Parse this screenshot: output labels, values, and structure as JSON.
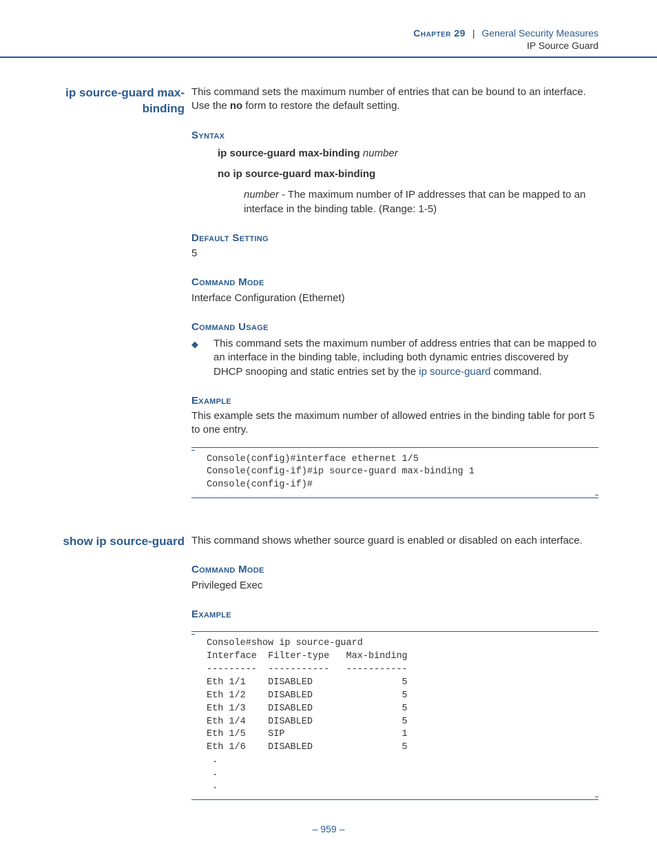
{
  "header": {
    "chapter": "Chapter 29",
    "title": "General Security Measures",
    "subtitle": "IP Source Guard"
  },
  "section1": {
    "heading": "ip source-guard max-binding",
    "intro_pre": "This command sets the maximum number of entries that can be bound to an interface. Use the ",
    "intro_bold": "no",
    "intro_post": " form to restore the default setting.",
    "syntax_label": "Syntax",
    "syntax_line1_bold": "ip source-guard max-binding ",
    "syntax_line1_italic": "number",
    "syntax_line2_bold": "no ip source-guard max-binding",
    "param_italic": "number",
    "param_desc": " - The maximum number of IP addresses that can be mapped to an interface in the binding table. (Range: 1-5)",
    "default_label": "Default Setting",
    "default_value": "5",
    "mode_label": "Command Mode",
    "mode_value": "Interface Configuration (Ethernet)",
    "usage_label": "Command Usage",
    "usage_pre": "This command sets the maximum number of address entries that can be mapped to an interface in the binding table, including both dynamic entries discovered by DHCP snooping and static entries set by the ",
    "usage_link": "ip source-guard",
    "usage_post": " command.",
    "example_label": "Example",
    "example_text": "This example sets the maximum number of allowed entries in the binding table for port 5 to one entry.",
    "code": "Console(config)#interface ethernet 1/5\nConsole(config-if)#ip source-guard max-binding 1\nConsole(config-if)#"
  },
  "section2": {
    "heading": "show ip source-guard",
    "intro": "This command shows whether source guard is enabled or disabled on each interface.",
    "mode_label": "Command Mode",
    "mode_value": "Privileged Exec",
    "example_label": "Example",
    "code": "Console#show ip source-guard\nInterface  Filter-type   Max-binding\n---------  -----------   -----------\nEth 1/1    DISABLED                5\nEth 1/2    DISABLED                5\nEth 1/3    DISABLED                5\nEth 1/4    DISABLED                5\nEth 1/5    SIP                     1\nEth 1/6    DISABLED                5\n .\n .\n ."
  },
  "page_number": "– 959 –"
}
